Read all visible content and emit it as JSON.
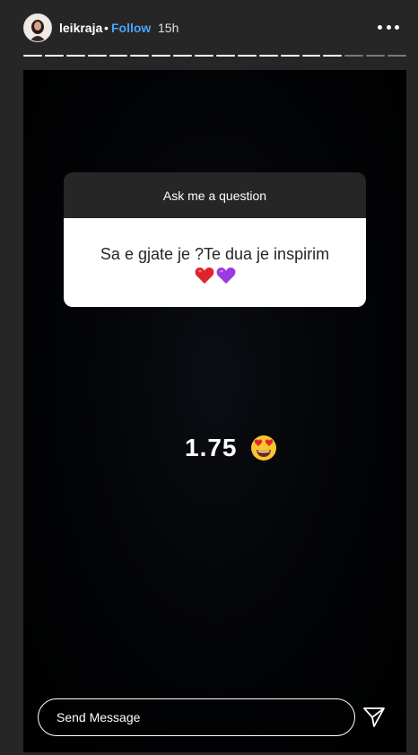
{
  "header": {
    "username": "leikraja",
    "separator": "•",
    "follow_label": "Follow",
    "time": "15h",
    "more_icon": "more-horizontal-icon"
  },
  "progress": {
    "total_segments": 18,
    "viewed_segments": 15
  },
  "question_sticker": {
    "title": "Ask me a question",
    "question": "Sa e gjate je ?Te dua je inspirim",
    "emoji": [
      "red-heart",
      "purple-heart"
    ]
  },
  "answer": {
    "text": "1.75",
    "emoji": "heart-eyes-face"
  },
  "footer": {
    "send_placeholder": "Send Message",
    "send_icon": "paper-plane-icon"
  },
  "colors": {
    "background": "#262626",
    "story": "#000000",
    "follow": "#4aa3f5",
    "card_header": "#262626",
    "card_body": "#ffffff"
  }
}
